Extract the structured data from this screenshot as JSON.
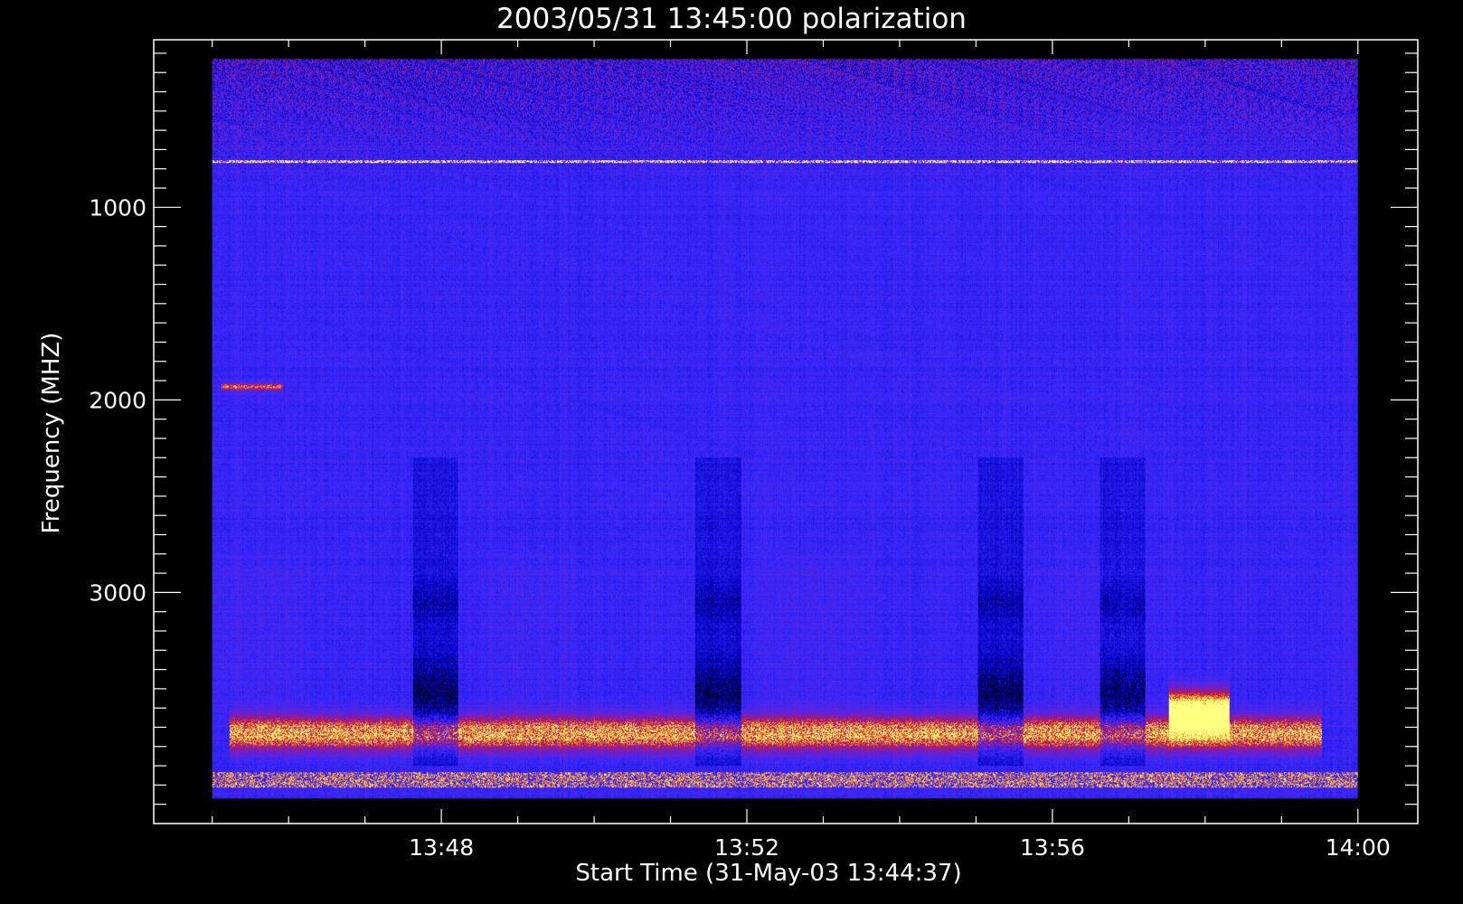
{
  "chart_data": {
    "type": "heatmap",
    "title": "2003/05/31 13:45:00 polarization",
    "xlabel": "Start Time (31-May-03 13:44:37)",
    "ylabel": "Frequency (MHZ)",
    "x_ticks": [
      "13:48",
      "13:52",
      "13:56",
      "14:00"
    ],
    "x_tick_minutes": [
      3.383,
      7.383,
      11.383,
      15.383
    ],
    "x_data_range_minutes": [
      0.383,
      15.383
    ],
    "x_axis_range_minutes": [
      -0.383,
      16.167
    ],
    "y_ticks": [
      "1000",
      "2000",
      "3000"
    ],
    "y_tick_values": [
      1000,
      2000,
      3000
    ],
    "y_axis_range": [
      130,
      4200
    ],
    "y_data_range": [
      230,
      4070
    ],
    "y_reversed": true,
    "colormap": [
      "#000000",
      "#0000c0",
      "#3a2aff",
      "#8a1ab0",
      "#d01a10",
      "#ffaa40",
      "#ffff80"
    ],
    "features": [
      {
        "kind": "bright_band",
        "freq": 760,
        "intensity": 0.6
      },
      {
        "kind": "red_burst",
        "freq": 1930,
        "t_start": 0.5,
        "t_end": 1.3,
        "intensity": 0.55
      },
      {
        "kind": "red_burst",
        "freq": 3730,
        "t_start": 0.6,
        "t_end": 14.9,
        "intensity": 0.7
      },
      {
        "kind": "hot_spot",
        "freq": 3620,
        "t_start": 12.9,
        "t_end": 13.7,
        "intensity": 1.0
      },
      {
        "kind": "dark_column",
        "t_start": 3.0,
        "t_end": 3.6
      },
      {
        "kind": "dark_column",
        "t_start": 6.7,
        "t_end": 7.3
      },
      {
        "kind": "dark_column",
        "t_start": 10.4,
        "t_end": 11.0
      },
      {
        "kind": "dark_column",
        "t_start": 12.0,
        "t_end": 12.6
      },
      {
        "kind": "stripe_band",
        "freq": 3970,
        "intensity": 0.8
      }
    ]
  }
}
